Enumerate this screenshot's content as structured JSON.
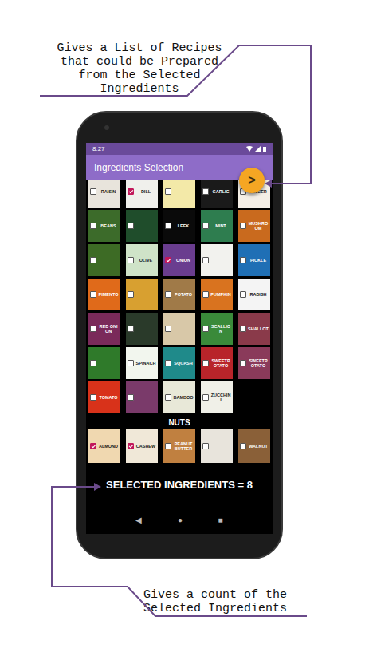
{
  "annotations": {
    "top": [
      "Gives a List of Recipes",
      "that could be Prepared",
      "from the Selected",
      "Ingredients"
    ],
    "bottom": [
      "Gives a count of the",
      "Selected Ingredients"
    ]
  },
  "status_bar": {
    "time": "8:27"
  },
  "app_bar": {
    "title": "Ingredients Selection",
    "fab": ">"
  },
  "ingredients": [
    {
      "label": "RAISIN",
      "checked": false,
      "color": "#e8e4dc"
    },
    {
      "label": "DILL",
      "checked": true,
      "color": "#f0f0ec"
    },
    {
      "label": "",
      "checked": false,
      "color": "#f3e9a8"
    },
    {
      "label": "GARLIC",
      "checked": false,
      "color": "#1a1a1a"
    },
    {
      "label": "GINGER",
      "checked": false,
      "color": "#f4efe6"
    },
    {
      "label": "BEANS",
      "checked": false,
      "color": "#3c6b2a"
    },
    {
      "label": "",
      "checked": false,
      "color": "#1f4d2b"
    },
    {
      "label": "LEEK",
      "checked": false,
      "color": "#0a0a0a"
    },
    {
      "label": "MINT",
      "checked": false,
      "color": "#2e7d4f"
    },
    {
      "label": "MUSHROOM",
      "checked": false,
      "color": "#c96a1e"
    },
    {
      "label": "",
      "checked": false,
      "color": "#3d6b25"
    },
    {
      "label": "OLIVE",
      "checked": false,
      "color": "#cfe3c8"
    },
    {
      "label": "ONION",
      "checked": true,
      "color": "#6a3d8f"
    },
    {
      "label": "",
      "checked": false,
      "color": "#f2f2ee"
    },
    {
      "label": "PICKLE",
      "checked": false,
      "color": "#1f6fb5"
    },
    {
      "label": "PIMENTO",
      "checked": false,
      "color": "#e06a1a"
    },
    {
      "label": "",
      "checked": false,
      "color": "#d8a030"
    },
    {
      "label": "POTATO",
      "checked": false,
      "color": "#a07a48"
    },
    {
      "label": "PUMPKIN",
      "checked": false,
      "color": "#d9731f"
    },
    {
      "label": "RADISH",
      "checked": false,
      "color": "#f4f4f4"
    },
    {
      "label": "RED ONION",
      "checked": false,
      "color": "#7a2a5a"
    },
    {
      "label": "",
      "checked": false,
      "color": "#2a3a2a"
    },
    {
      "label": "",
      "checked": false,
      "color": "#d8c8a8"
    },
    {
      "label": "SCALLION",
      "checked": false,
      "color": "#3a8a3a"
    },
    {
      "label": "SHALLOT",
      "checked": false,
      "color": "#8a3a4a"
    },
    {
      "label": "",
      "checked": false,
      "color": "#2f7a2a"
    },
    {
      "label": "SPINACH",
      "checked": false,
      "color": "#f2f6ee"
    },
    {
      "label": "SQUASH",
      "checked": false,
      "color": "#1f8a8a"
    },
    {
      "label": "SWEETPOTATO",
      "checked": false,
      "color": "#b8242a"
    },
    {
      "label": "SWEETPOTATO",
      "checked": false,
      "color": "#8a3a5a"
    },
    {
      "label": "TOMATO",
      "checked": false,
      "color": "#d8321a"
    },
    {
      "label": "",
      "checked": false,
      "color": "#7a3a6a"
    },
    {
      "label": "BAMBOO",
      "checked": false,
      "color": "#e8e8d8"
    },
    {
      "label": "ZUCCHINI",
      "checked": false,
      "color": "#f0f0e8"
    }
  ],
  "section": {
    "title": "NUTS",
    "items": [
      {
        "label": "ALMOND",
        "checked": true,
        "color": "#f0d8b0"
      },
      {
        "label": "CASHEW",
        "checked": true,
        "color": "#f0e8d8"
      },
      {
        "label": "PEANUT BUTTER",
        "checked": false,
        "color": "#c08040"
      },
      {
        "label": "",
        "checked": false,
        "color": "#e8e4dc"
      },
      {
        "label": "WALNUT",
        "checked": false,
        "color": "#8a6038"
      }
    ]
  },
  "selected_count": "SELECTED INGREDIENTS = 8",
  "nav": [
    "◀",
    "●",
    "■"
  ]
}
